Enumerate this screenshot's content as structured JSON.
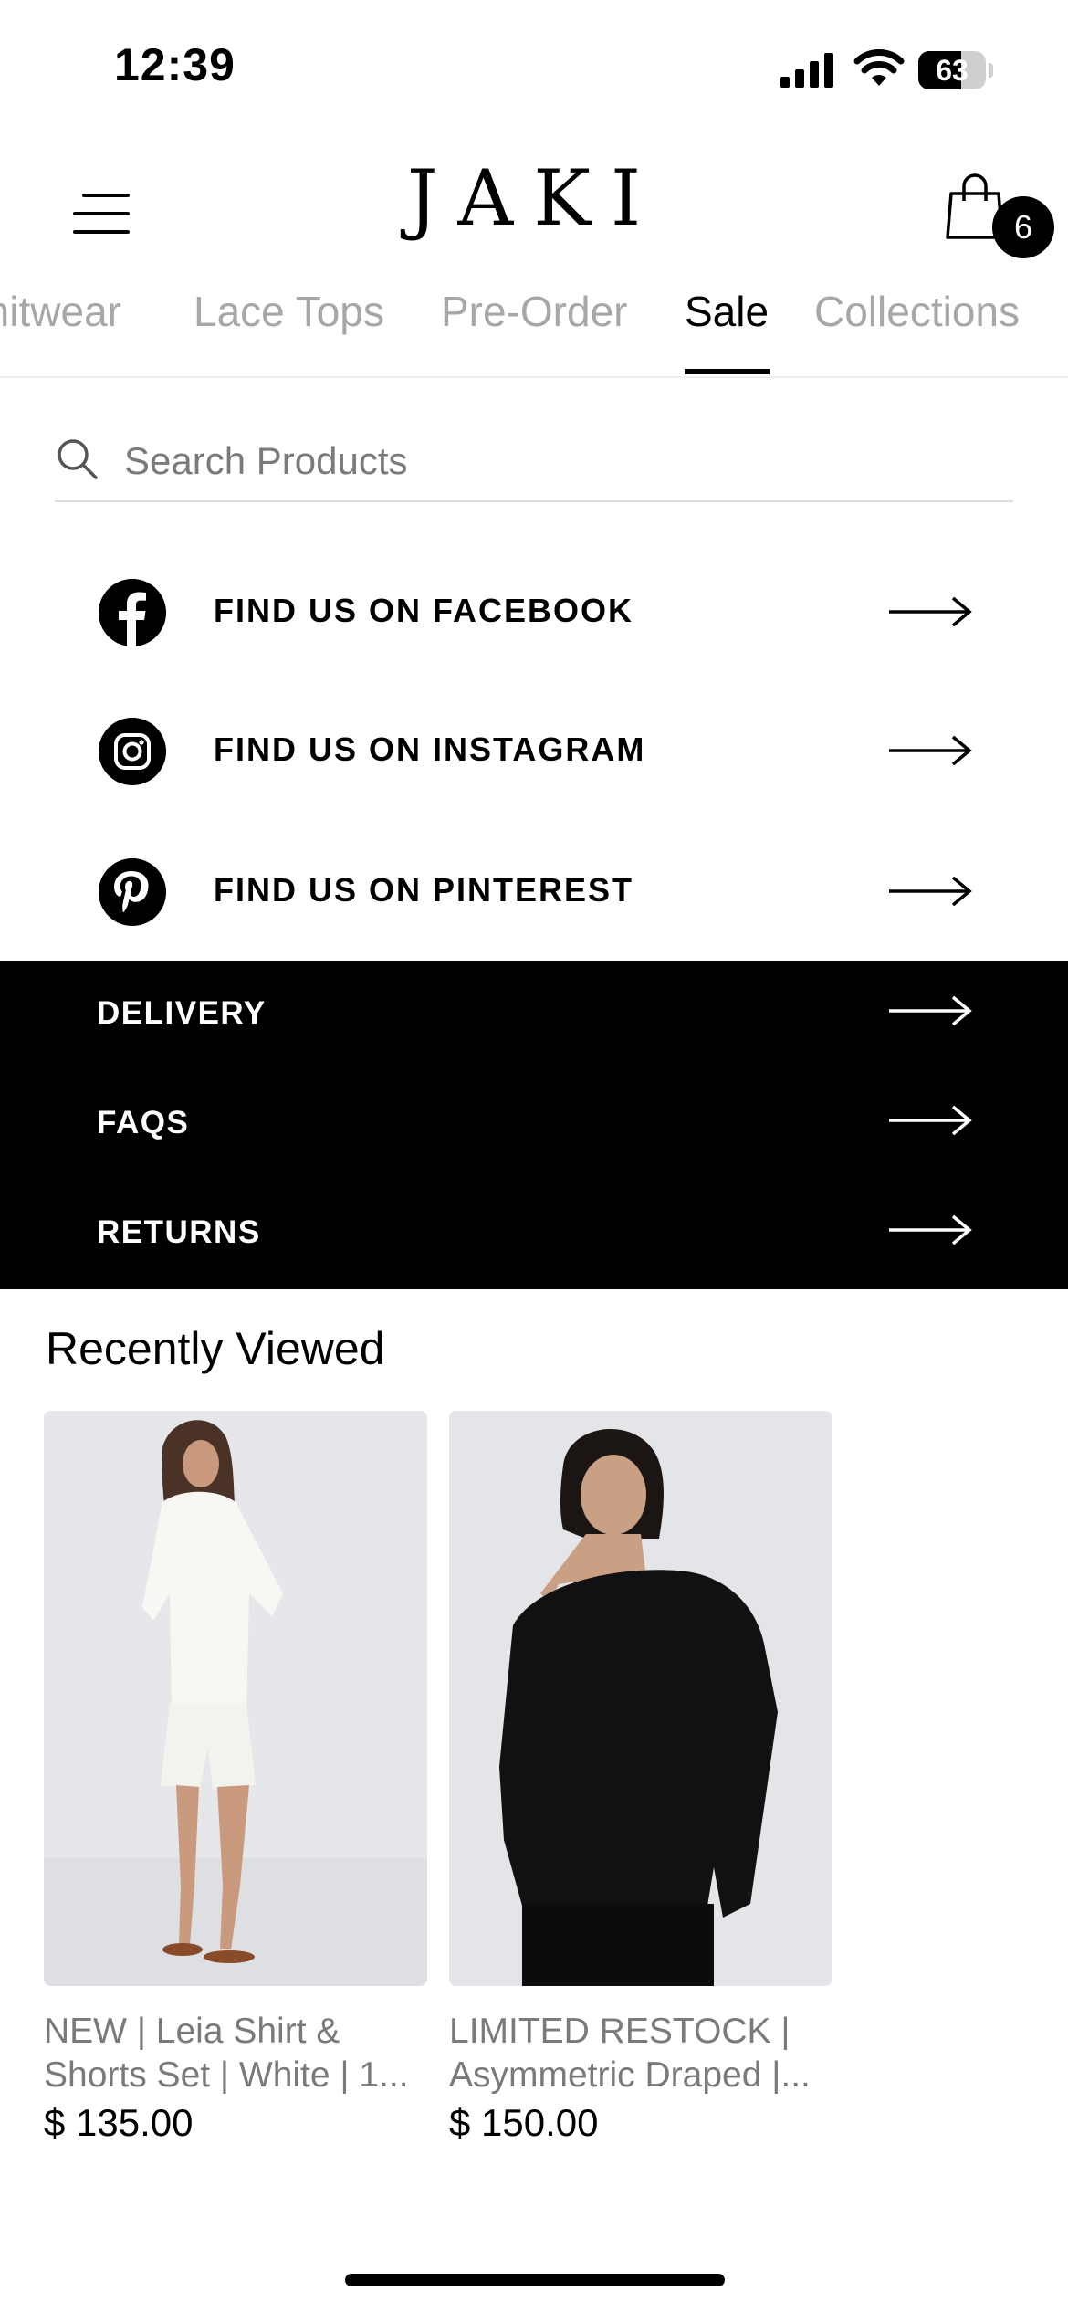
{
  "status_bar": {
    "time": "12:39",
    "battery": "63",
    "battery_level": 0.63
  },
  "header": {
    "logo": "JAKI",
    "cart_count": "6"
  },
  "tabs": [
    {
      "label": "Knitwear",
      "active": false
    },
    {
      "label": "Lace Tops",
      "active": false
    },
    {
      "label": "Pre-Order",
      "active": false
    },
    {
      "label": "Sale",
      "active": true
    },
    {
      "label": "Collections",
      "active": false
    }
  ],
  "search": {
    "placeholder": "Search Products",
    "value": ""
  },
  "social": [
    {
      "label": "FIND US ON FACEBOOK",
      "icon": "facebook-icon"
    },
    {
      "label": "FIND US ON INSTAGRAM",
      "icon": "instagram-icon"
    },
    {
      "label": "FIND US ON PINTEREST",
      "icon": "pinterest-icon"
    }
  ],
  "info_links": [
    {
      "label": "DELIVERY"
    },
    {
      "label": "FAQS"
    },
    {
      "label": "RETURNS"
    }
  ],
  "recently_viewed": {
    "title": "Recently Viewed",
    "products": [
      {
        "name_line1": "NEW | Leia Shirt &",
        "name_line2": "Shorts Set | White | 1...",
        "price": "$ 135.00"
      },
      {
        "name_line1": "LIMITED RESTOCK |",
        "name_line2": "Asymmetric Draped |...",
        "price": "$ 150.00"
      }
    ]
  },
  "colors": {
    "accent": "#000000",
    "tab_inactive": "#a7a7a7",
    "muted_text": "#7a7a7a",
    "info_bg": "#000000"
  }
}
